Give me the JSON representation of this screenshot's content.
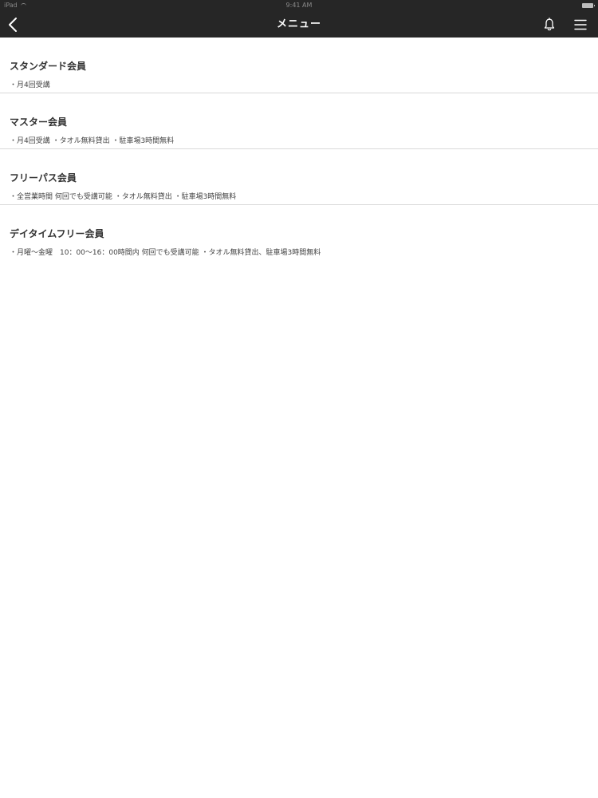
{
  "status_bar": {
    "carrier": "iPad",
    "time": "9:41 AM"
  },
  "nav": {
    "title": "メニュー",
    "back_icon": "chevron-left-icon",
    "bell_icon": "bell-icon",
    "menu_icon": "hamburger-menu-icon",
    "background_color": "#262626"
  },
  "plans": [
    {
      "name": "スタンダード会員",
      "description": "・月4回受講"
    },
    {
      "name": "マスター会員",
      "description": "・月4回受講 ・タオル無料貸出 ・駐車場3時間無料"
    },
    {
      "name": "フリーパス会員",
      "description": "・全営業時間 何回でも受講可能 ・タオル無料貸出 ・駐車場3時間無料"
    },
    {
      "name": "デイタイムフリー会員",
      "description": "・月曜～金曜　10：00～16：00時間内 何回でも受講可能 ・タオル無料貸出、駐車場3時間無料"
    }
  ]
}
